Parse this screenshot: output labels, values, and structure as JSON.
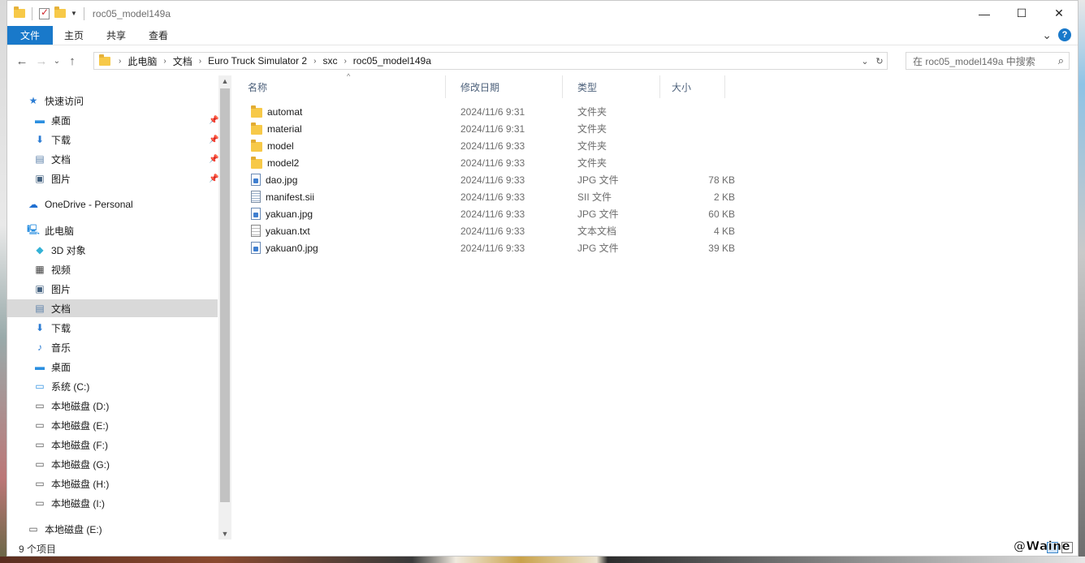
{
  "window": {
    "title": "roc05_model149a",
    "controls": {
      "minimize": "—",
      "maximize": "☐",
      "close": "✕"
    }
  },
  "ribbon": {
    "tabs": [
      "文件",
      "主页",
      "共享",
      "查看"
    ],
    "expand_glyph": "⌄",
    "help_glyph": "?"
  },
  "nav": {
    "back": "←",
    "forward": "→",
    "up_dropdown": "⌄",
    "up": "↑"
  },
  "address": {
    "crumbs": [
      "此电脑",
      "文档",
      "Euro Truck Simulator 2",
      "sxc",
      "roc05_model149a"
    ]
  },
  "search": {
    "placeholder": "在 roc05_model149a 中搜索"
  },
  "sidebar": {
    "items": [
      {
        "label": "快速访问",
        "icon": "star-icon",
        "glyph": "★",
        "color": "#2b7cd3",
        "pinned": false,
        "selected": false
      },
      {
        "label": "桌面",
        "icon": "desktop-icon",
        "glyph": "▬",
        "color": "#2b8fe0",
        "pinned": true,
        "selected": false
      },
      {
        "label": "下载",
        "icon": "download-icon",
        "glyph": "⬇",
        "color": "#2b7cd3",
        "pinned": true,
        "selected": false
      },
      {
        "label": "文档",
        "icon": "document-icon",
        "glyph": "▤",
        "color": "#5a7fa8",
        "pinned": true,
        "selected": false
      },
      {
        "label": "图片",
        "icon": "pictures-icon",
        "glyph": "▣",
        "color": "#44617f",
        "pinned": true,
        "selected": false
      },
      {
        "label": "OneDrive - Personal",
        "icon": "cloud-icon",
        "glyph": "☁",
        "color": "#1f6fd1",
        "pinned": false,
        "selected": false
      },
      {
        "label": "此电脑",
        "icon": "computer-icon",
        "glyph": "🖳",
        "color": "#2b8fe0",
        "pinned": false,
        "selected": false
      },
      {
        "label": "3D 对象",
        "icon": "3d-objects-icon",
        "glyph": "◆",
        "color": "#34b2d6",
        "pinned": false,
        "selected": false
      },
      {
        "label": "视频",
        "icon": "video-icon",
        "glyph": "▦",
        "color": "#444",
        "pinned": false,
        "selected": false
      },
      {
        "label": "图片",
        "icon": "pictures-icon",
        "glyph": "▣",
        "color": "#44617f",
        "pinned": false,
        "selected": false
      },
      {
        "label": "文档",
        "icon": "document-icon",
        "glyph": "▤",
        "color": "#5a7fa8",
        "pinned": false,
        "selected": true
      },
      {
        "label": "下载",
        "icon": "download-icon",
        "glyph": "⬇",
        "color": "#2b7cd3",
        "pinned": false,
        "selected": false
      },
      {
        "label": "音乐",
        "icon": "music-icon",
        "glyph": "♪",
        "color": "#2b7cd3",
        "pinned": false,
        "selected": false
      },
      {
        "label": "桌面",
        "icon": "desktop-icon",
        "glyph": "▬",
        "color": "#2b8fe0",
        "pinned": false,
        "selected": false
      },
      {
        "label": "系统 (C:)",
        "icon": "windows-drive-icon",
        "glyph": "▭",
        "color": "#2b8fe0",
        "pinned": false,
        "selected": false
      },
      {
        "label": "本地磁盘 (D:)",
        "icon": "drive-icon",
        "glyph": "▭",
        "color": "#555",
        "pinned": false,
        "selected": false
      },
      {
        "label": "本地磁盘 (E:)",
        "icon": "drive-icon",
        "glyph": "▭",
        "color": "#555",
        "pinned": false,
        "selected": false
      },
      {
        "label": "本地磁盘 (F:)",
        "icon": "drive-icon",
        "glyph": "▭",
        "color": "#555",
        "pinned": false,
        "selected": false
      },
      {
        "label": "本地磁盘 (G:)",
        "icon": "drive-icon",
        "glyph": "▭",
        "color": "#555",
        "pinned": false,
        "selected": false
      },
      {
        "label": "本地磁盘 (H:)",
        "icon": "drive-icon",
        "glyph": "▭",
        "color": "#555",
        "pinned": false,
        "selected": false
      },
      {
        "label": "本地磁盘 (I:)",
        "icon": "drive-icon",
        "glyph": "▭",
        "color": "#555",
        "pinned": false,
        "selected": false
      },
      {
        "label": "本地磁盘 (E:)",
        "icon": "drive-icon",
        "glyph": "▭",
        "color": "#555",
        "pinned": false,
        "selected": false
      }
    ]
  },
  "columns": {
    "name": "名称",
    "date": "修改日期",
    "type": "类型",
    "size": "大小"
  },
  "files": [
    {
      "name": "automat",
      "date": "2024/11/6 9:31",
      "type": "文件夹",
      "size": "",
      "kind": "folder"
    },
    {
      "name": "material",
      "date": "2024/11/6 9:31",
      "type": "文件夹",
      "size": "",
      "kind": "folder"
    },
    {
      "name": "model",
      "date": "2024/11/6 9:33",
      "type": "文件夹",
      "size": "",
      "kind": "folder"
    },
    {
      "name": "model2",
      "date": "2024/11/6 9:33",
      "type": "文件夹",
      "size": "",
      "kind": "folder"
    },
    {
      "name": "dao.jpg",
      "date": "2024/11/6 9:33",
      "type": "JPG 文件",
      "size": "78 KB",
      "kind": "jpg"
    },
    {
      "name": "manifest.sii",
      "date": "2024/11/6 9:33",
      "type": "SII 文件",
      "size": "2 KB",
      "kind": "sii"
    },
    {
      "name": "yakuan.jpg",
      "date": "2024/11/6 9:33",
      "type": "JPG 文件",
      "size": "60 KB",
      "kind": "jpg"
    },
    {
      "name": "yakuan.txt",
      "date": "2024/11/6 9:33",
      "type": "文本文档",
      "size": "4 KB",
      "kind": "txt"
    },
    {
      "name": "yakuan0.jpg",
      "date": "2024/11/6 9:33",
      "type": "JPG 文件",
      "size": "39 KB",
      "kind": "jpg"
    }
  ],
  "status": {
    "item_count": "9 个项目"
  },
  "watermark": "@Waine",
  "colors": {
    "accent": "#1979ca",
    "selection": "#d9d9d9",
    "header_text": "#4c607a"
  }
}
